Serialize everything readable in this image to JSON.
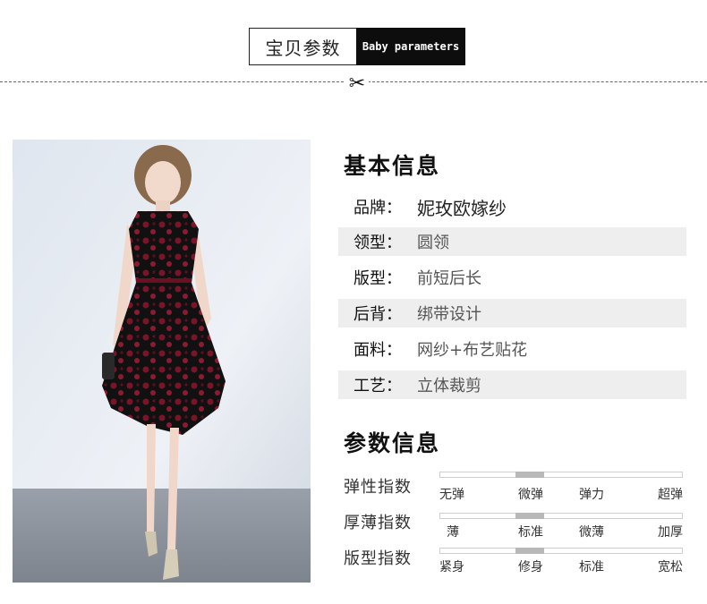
{
  "header": {
    "title_cn": "宝贝参数",
    "title_en": "Baby parameters",
    "divider_icon": "scissors-icon"
  },
  "basic_info": {
    "title": "基本信息",
    "rows": [
      {
        "key": "品牌：",
        "value": "妮玫欧嫁纱"
      },
      {
        "key": "领型：",
        "value": "圆领"
      },
      {
        "key": "版型：",
        "value": "前短后长"
      },
      {
        "key": "后背：",
        "value": "绑带设计"
      },
      {
        "key": "面料：",
        "value": "网纱+布艺贴花"
      },
      {
        "key": "工艺：",
        "value": "立体裁剪"
      }
    ]
  },
  "params": {
    "title": "参数信息",
    "items": [
      {
        "label": "弹性指数",
        "ticks": [
          "无弹",
          "微弹",
          "弹力",
          "超弹"
        ],
        "selected_index": 1
      },
      {
        "label": "厚薄指数",
        "ticks": [
          "薄",
          "标准",
          "微薄",
          "加厚"
        ],
        "selected_index": 1
      },
      {
        "label": "版型指数",
        "ticks": [
          "紧身",
          "修身",
          "标准",
          "宽松"
        ],
        "selected_index": 1
      }
    ]
  },
  "colors": {
    "banner_dark": "#0d0d0d",
    "row_shade": "#eeeeee",
    "bar_fill": "#b8b8b8",
    "dress_burgundy": "#7a1428"
  }
}
